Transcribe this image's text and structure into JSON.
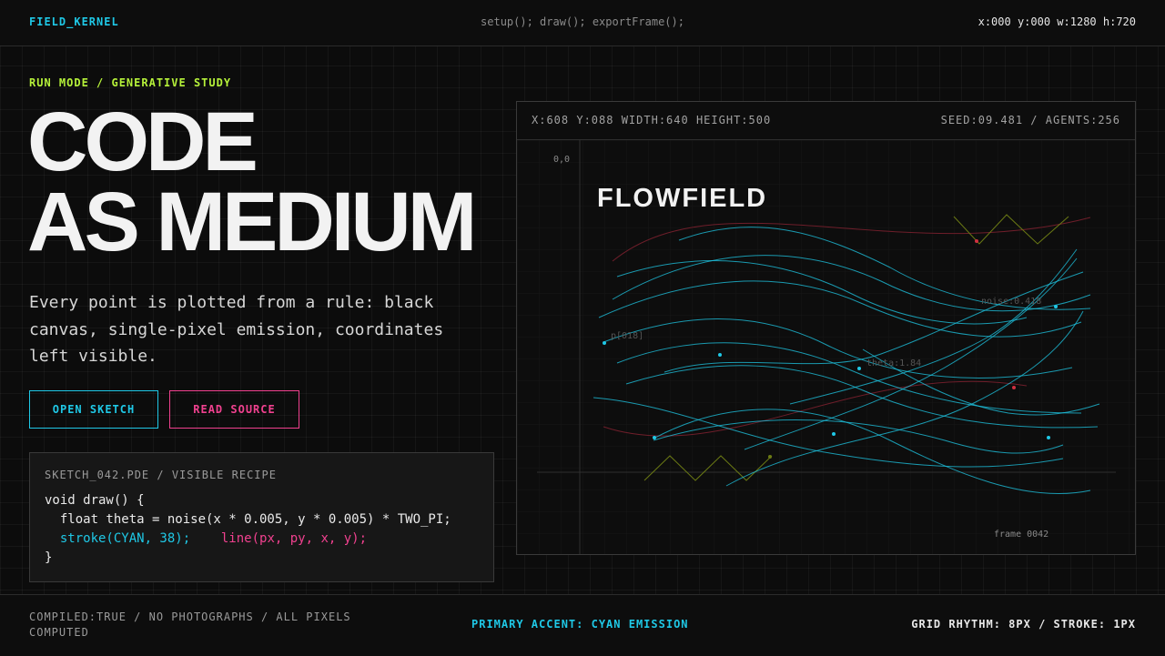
{
  "topbar": {
    "brand": "FIELD_KERNEL",
    "calls": "setup(); draw(); exportFrame();",
    "coords": "x:000 y:000 w:1280 h:720"
  },
  "hero": {
    "kicker": "RUN MODE / GENERATIVE STUDY",
    "headline_line1": "CODE",
    "headline_line2": "AS MEDIUM",
    "description": "Every point is plotted from a rule: black canvas, single-pixel emission, coordinates left visible."
  },
  "buttons": {
    "open_label": "OPEN SKETCH",
    "read_label": "READ SOURCE"
  },
  "code_panel": {
    "title": "SKETCH_042.PDE / VISIBLE RECIPE",
    "line1": "void draw() {",
    "line2": "  float theta = noise(x * 0.005, y * 0.005) * TWO_PI;",
    "line3_stroke": "  stroke(CYAN, 38);",
    "line3_line": "  line(px, py, x, y);",
    "line4": "}"
  },
  "canvas": {
    "header_left": "X:608 Y:088 WIDTH:640 HEIGHT:500",
    "header_right": "SEED:09.481 / AGENTS:256",
    "origin_label": "0,0",
    "title": "FLOWFIELD",
    "label_noise": "noise:0.418",
    "label_p": "p[018]",
    "label_theta": "theta:1.84",
    "frame_label": "frame 0042",
    "colors": {
      "cyan": "#1fc8e6",
      "crimson": "#6e1e2a",
      "olive": "#6b7a14",
      "red_dot": "#d03040"
    }
  },
  "footer": {
    "left": "COMPILED:TRUE / NO PHOTOGRAPHS / ALL PIXELS COMPUTED",
    "center": "PRIMARY ACCENT: CYAN EMISSION",
    "right": "GRID RHYTHM: 8PX / STROKE: 1PX"
  },
  "theme": {
    "background": "#0c0c0c",
    "accent_cyan": "#1fc8e6",
    "accent_pink": "#f0418f",
    "accent_lime": "#b6f23a"
  }
}
